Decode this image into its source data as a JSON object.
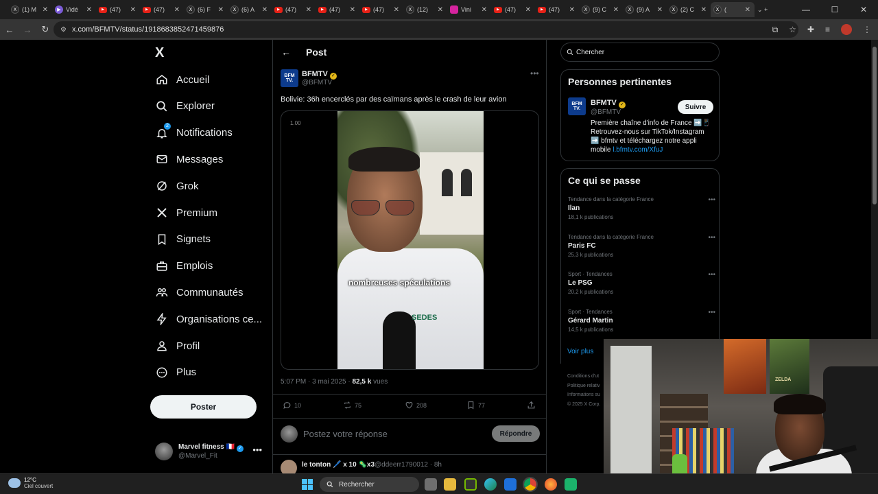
{
  "browser": {
    "tabs": [
      {
        "icon": "x-icon",
        "label": "(1) M"
      },
      {
        "icon": "video-icon",
        "label": "Vidé"
      },
      {
        "icon": "youtube-icon",
        "label": "(47)"
      },
      {
        "icon": "youtube-icon",
        "label": "(47)"
      },
      {
        "icon": "x-icon",
        "label": "(6) F"
      },
      {
        "icon": "x-icon",
        "label": "(6) A"
      },
      {
        "icon": "youtube-icon",
        "label": "(47)"
      },
      {
        "icon": "youtube-icon",
        "label": "(47)"
      },
      {
        "icon": "youtube-icon",
        "label": "(47)"
      },
      {
        "icon": "x-icon",
        "label": "(12)"
      },
      {
        "icon": "instagram-icon",
        "label": "Vini"
      },
      {
        "icon": "youtube-icon",
        "label": "(47)"
      },
      {
        "icon": "youtube-icon",
        "label": "(47)"
      },
      {
        "icon": "x-icon",
        "label": "(9) C"
      },
      {
        "icon": "x-icon",
        "label": "(9) A"
      },
      {
        "icon": "x-icon",
        "label": "(2) C"
      },
      {
        "icon": "x-icon",
        "label": "("
      }
    ],
    "url": "x.com/BFMTV/status/1918683852471459876"
  },
  "nav": {
    "logo": "X",
    "items": [
      {
        "label": "Accueil",
        "icon": "home-icon"
      },
      {
        "label": "Explorer",
        "icon": "search-icon"
      },
      {
        "label": "Notifications",
        "icon": "bell-icon",
        "badge": "2"
      },
      {
        "label": "Messages",
        "icon": "mail-icon"
      },
      {
        "label": "Grok",
        "icon": "grok-icon"
      },
      {
        "label": "Premium",
        "icon": "x-premium-icon"
      },
      {
        "label": "Signets",
        "icon": "bookmark-icon"
      },
      {
        "label": "Emplois",
        "icon": "briefcase-icon"
      },
      {
        "label": "Communautés",
        "icon": "people-icon"
      },
      {
        "label": "Organisations ce...",
        "icon": "lightning-icon"
      },
      {
        "label": "Profil",
        "icon": "person-icon"
      },
      {
        "label": "Plus",
        "icon": "more-circle-icon"
      }
    ],
    "post_button": "Poster",
    "account": {
      "name": "Marvel fitness 🇫🇷",
      "handle": "@Marvel_Fit"
    }
  },
  "post": {
    "header_title": "Post",
    "author": {
      "name": "BFMTV",
      "handle": "@BFMTV",
      "avatar_text": "BFM TV."
    },
    "text": "Bolivie: 36h encerclés par des caïmans après le crash de leur avion",
    "video": {
      "speed": "1.00",
      "caption": "nombreuses spéculations",
      "mic_logo": "SEDES"
    },
    "timestamp": "5:07 PM · 3 mai 2025 · ",
    "views": "82,5 k",
    "views_label": " vues",
    "stats": {
      "replies": "10",
      "reposts": "75",
      "likes": "208",
      "bookmarks": "77"
    },
    "reply_placeholder": "Postez votre réponse",
    "reply_button": "Répondre",
    "next_reply": {
      "name": "le tonton 🖊️ x 10 🦠x3",
      "handle": "@ddeerr1790012 · 8h"
    }
  },
  "sidebar": {
    "search_placeholder": "Chercher",
    "relevant": {
      "title": "Personnes pertinentes",
      "name": "BFMTV",
      "handle": "@BFMTV",
      "follow": "Suivre",
      "bio": "Première chaîne d'info de France ➡️📱 Retrouvez-nous sur TikTok/Instagram ➡️ bfmtv et téléchargez notre appli mobile ",
      "bio_link": "l.bfmtv.com/XfuJ"
    },
    "trends": {
      "title": "Ce qui se passe",
      "items": [
        {
          "context": "Tendance dans la catégorie France",
          "name": "Ilan",
          "count": "18,1 k publications"
        },
        {
          "context": "Tendance dans la catégorie France",
          "name": "Paris FC",
          "count": "25,3 k publications"
        },
        {
          "context": "Sport · Tendances",
          "name": "Le PSG",
          "count": "20,2 k publications"
        },
        {
          "context": "Sport · Tendances",
          "name": "Gérard Martin",
          "count": "14,5 k publications"
        }
      ],
      "more": "Voir plus"
    },
    "footer": [
      "Conditions d'ut",
      "Politique relativ",
      "Informations su",
      "© 2025 X Corp."
    ]
  },
  "webcam": {
    "poster_text": "ZELDA"
  },
  "taskbar": {
    "temperature": "12°C",
    "weather": "Ciel couvert",
    "search": "Rechercher"
  },
  "colors": {
    "accent": "#1d9bf0",
    "background": "#000000",
    "border": "#2f3336"
  }
}
